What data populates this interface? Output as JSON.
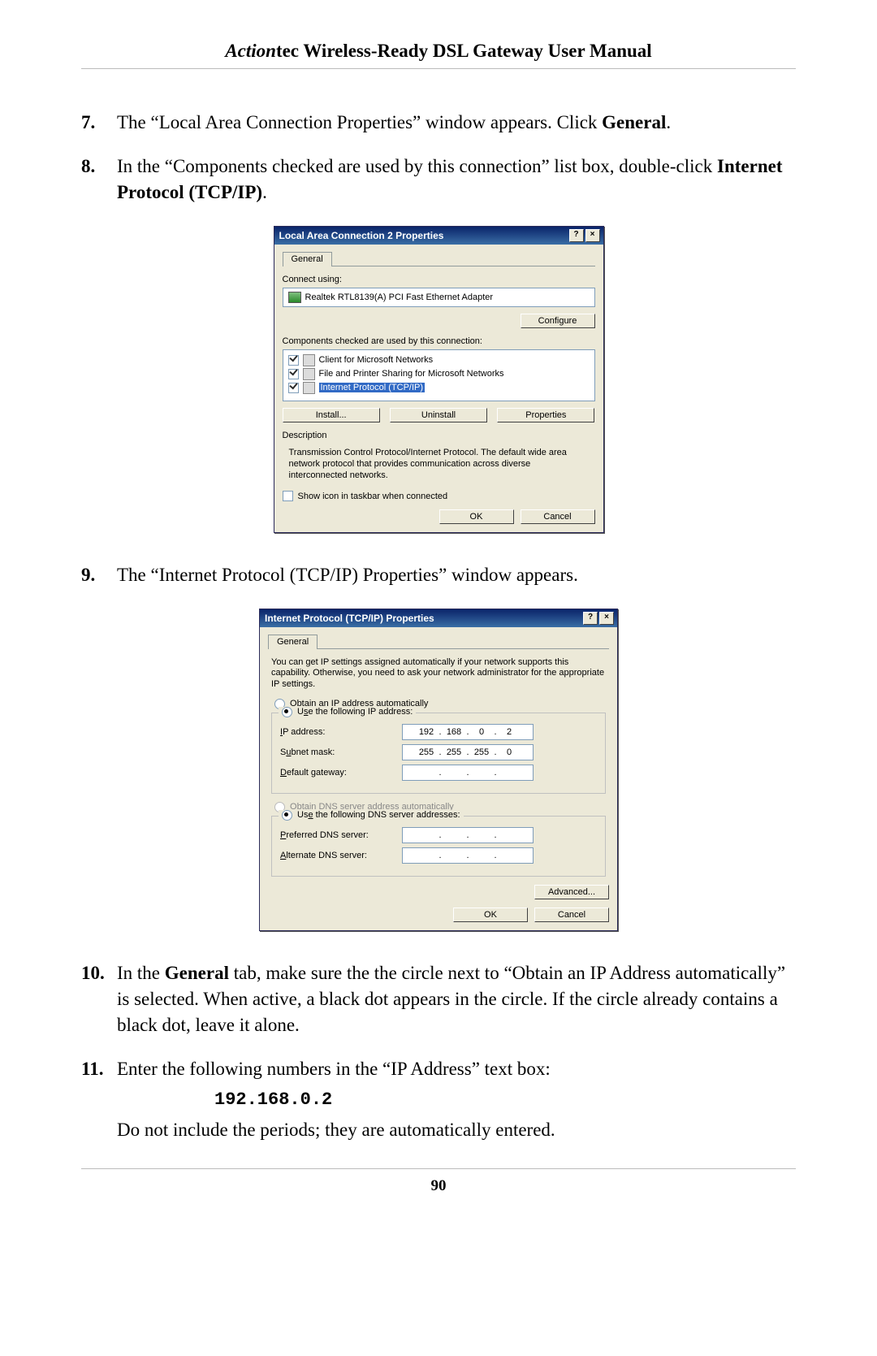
{
  "header": {
    "brand": "Action",
    "brand_suffix": "tec",
    "title_rest": " Wireless-Ready DSL Gateway User Manual"
  },
  "steps": {
    "s7": {
      "num": "7.",
      "p1": "The “Local Area Connection Properties” window appears. Click ",
      "p1b": "General",
      "p1c": "."
    },
    "s8": {
      "num": "8.",
      "p1": "In the “Components checked are used by this connection” list box, double-click ",
      "p1b": "Internet Protocol (TCP/IP)",
      "p1c": "."
    },
    "s9": {
      "num": "9.",
      "p1": "The “Internet Protocol (TCP/IP) Properties” window appears."
    },
    "s10": {
      "num": "10.",
      "p1": "In the ",
      "p1b": "General",
      "p1c": " tab, make sure the the circle next to “Obtain an IP Address automatically” is selected. When active, a black dot appears in the circle.  If the circle already contains a black dot, leave it alone."
    },
    "s11": {
      "num": "11.",
      "p1": "Enter the following numbers in the “IP Address” text box:",
      "ip": "192.168.0.2",
      "p2": "Do not include the periods; they are automatically entered."
    }
  },
  "dlg1": {
    "title": "Local Area Connection 2 Properties",
    "help": "?",
    "close": "×",
    "tab_general": "General",
    "connect_using": "Connect using:",
    "adapter": "Realtek RTL8139(A) PCI Fast Ethernet Adapter",
    "configure": "Configure",
    "components_lbl": "Components checked are used by this connection:",
    "c1": "Client for Microsoft Networks",
    "c2": "File and Printer Sharing for Microsoft Networks",
    "c3": "Internet Protocol (TCP/IP)",
    "install": "Install...",
    "uninstall": "Uninstall",
    "properties": "Properties",
    "desc_lbl": "Description",
    "desc": "Transmission Control Protocol/Internet Protocol. The default wide area network protocol that provides communication across diverse interconnected networks.",
    "show_icon": "Show icon in taskbar when connected",
    "ok": "OK",
    "cancel": "Cancel"
  },
  "dlg2": {
    "title": "Internet Protocol (TCP/IP) Properties",
    "help": "?",
    "close": "×",
    "tab_general": "General",
    "intro": "You can get IP settings assigned automatically if your network supports this capability. Otherwise, you need to ask your network administrator for the appropriate IP settings.",
    "r_obtain_ip": "Obtain an IP address automatically",
    "r_use_ip": "Use the following IP address:",
    "ip_label": "IP address:",
    "subnet_label": "Subnet mask:",
    "gw_label": "Default gateway:",
    "ip": {
      "a": "192",
      "b": "168",
      "c": "0",
      "d": "2"
    },
    "subnet": {
      "a": "255",
      "b": "255",
      "c": "255",
      "d": "0"
    },
    "gw": {
      "a": "",
      "b": "",
      "c": "",
      "d": ""
    },
    "r_obtain_dns": "Obtain DNS server address automatically",
    "r_use_dns": "Use the following DNS server addresses:",
    "pref_dns_label": "Preferred DNS server:",
    "alt_dns_label": "Alternate DNS server:",
    "pdns": {
      "a": "",
      "b": "",
      "c": "",
      "d": ""
    },
    "adns": {
      "a": "",
      "b": "",
      "c": "",
      "d": ""
    },
    "advanced": "Advanced...",
    "ok": "OK",
    "cancel": "Cancel"
  },
  "page_number": "90"
}
